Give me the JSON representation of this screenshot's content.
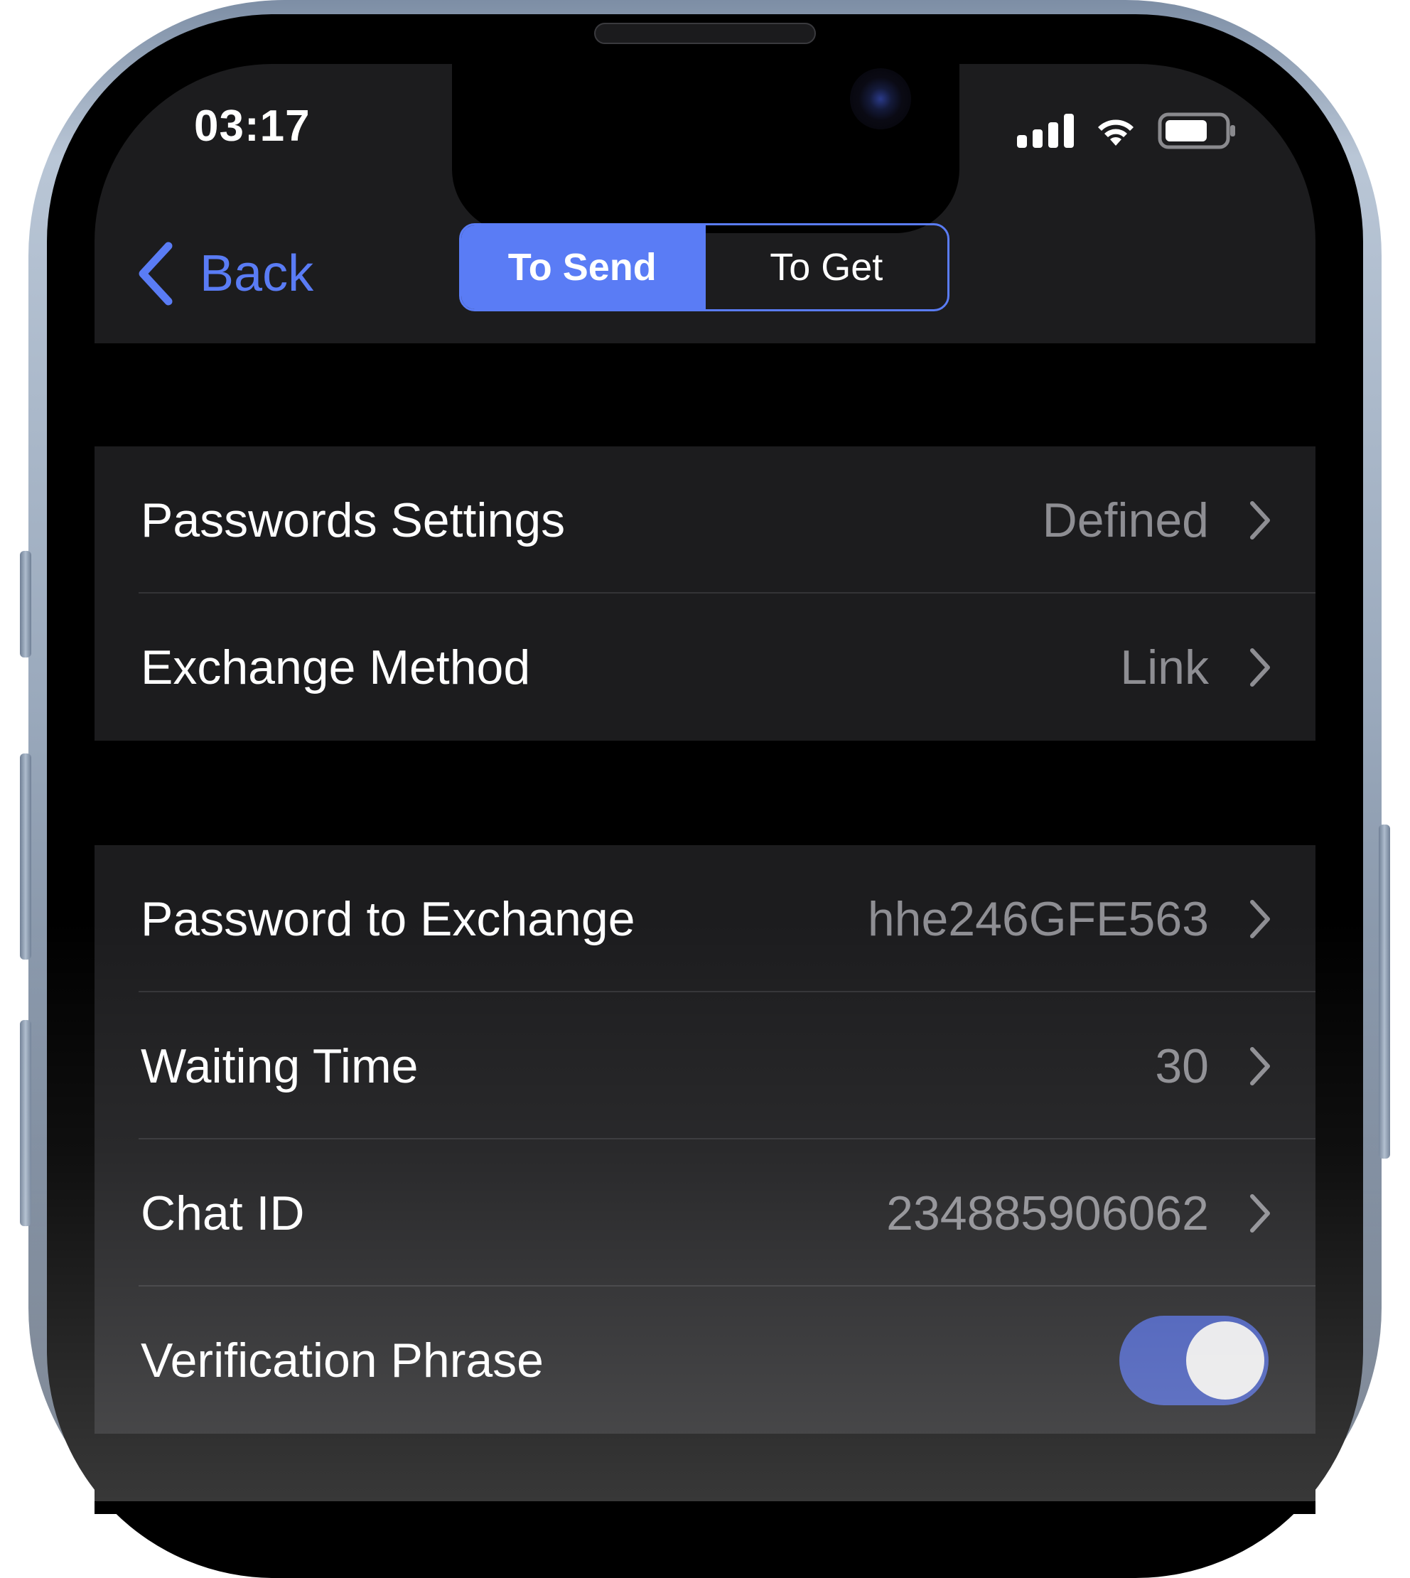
{
  "status_bar": {
    "time": "03:17"
  },
  "nav": {
    "back_label": "Back",
    "segments": [
      {
        "label": "To Send",
        "selected": true
      },
      {
        "label": "To Get",
        "selected": false
      }
    ]
  },
  "groups": [
    {
      "rows": [
        {
          "label": "Passwords Settings",
          "value": "Defined"
        },
        {
          "label": "Exchange Method",
          "value": "Link"
        }
      ]
    },
    {
      "rows": [
        {
          "label": "Password to Exchange",
          "value": "hhe246GFE563"
        },
        {
          "label": "Waiting Time",
          "value": "30"
        },
        {
          "label": "Chat ID",
          "value": "234885906062"
        }
      ],
      "toggle_row": {
        "label": "Verification Phrase",
        "on": true
      }
    }
  ],
  "colors": {
    "accent": "#5a7cf5",
    "row_background": "#1c1c1e",
    "secondary_text": "#8e8e93",
    "toggle_on": "#3e54b5"
  }
}
